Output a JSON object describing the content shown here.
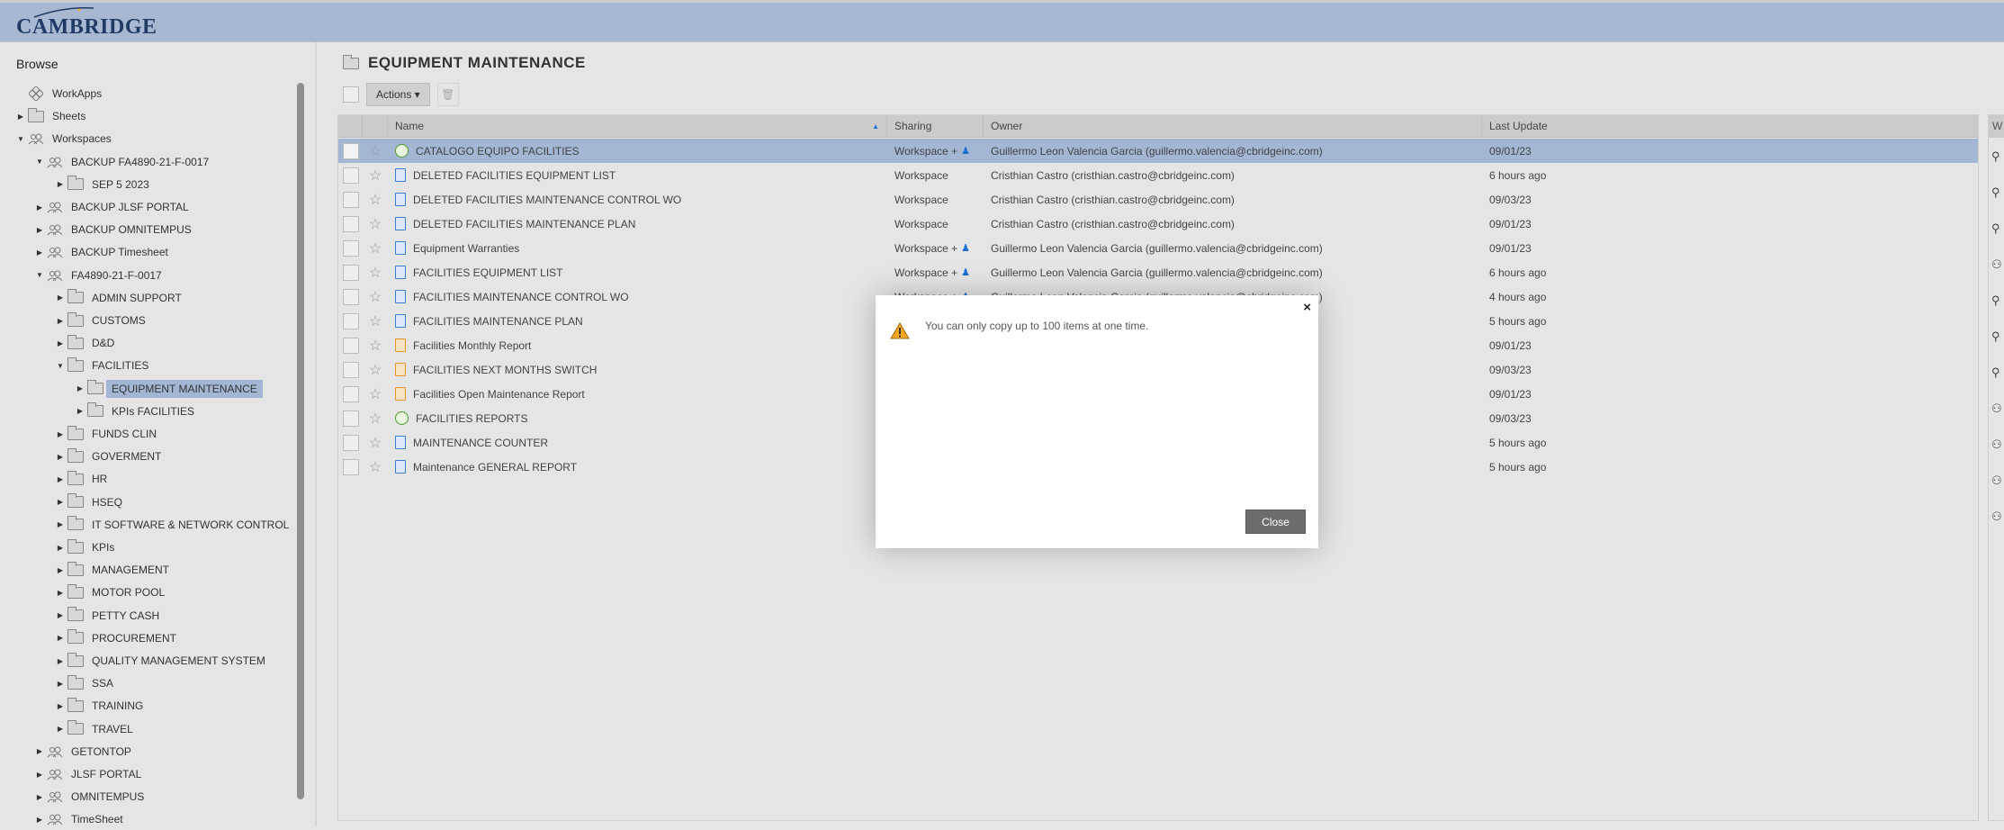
{
  "brand": {
    "logo": "CAMBRIDGE"
  },
  "sidebar": {
    "title": "Browse",
    "items": [
      {
        "label": "WorkApps",
        "level": 0,
        "state": "none",
        "icon": "workapps-icon"
      },
      {
        "label": "Sheets",
        "level": 0,
        "state": "collapsed",
        "icon": "folder-icon"
      },
      {
        "label": "Workspaces",
        "level": 0,
        "state": "expanded",
        "icon": "workspace-icon"
      },
      {
        "label": "BACKUP FA4890-21-F-0017",
        "level": 1,
        "state": "expanded",
        "icon": "workspace-icon"
      },
      {
        "label": "SEP 5 2023",
        "level": 2,
        "state": "collapsed",
        "icon": "folder-icon"
      },
      {
        "label": "BACKUP JLSF PORTAL",
        "level": 1,
        "state": "collapsed",
        "icon": "workspace-icon"
      },
      {
        "label": "BACKUP OMNITEMPUS",
        "level": 1,
        "state": "collapsed",
        "icon": "workspace-icon"
      },
      {
        "label": "BACKUP Timesheet",
        "level": 1,
        "state": "collapsed",
        "icon": "workspace-icon"
      },
      {
        "label": "FA4890-21-F-0017",
        "level": 1,
        "state": "expanded",
        "icon": "workspace-icon"
      },
      {
        "label": "ADMIN SUPPORT",
        "level": 2,
        "state": "collapsed",
        "icon": "folder-icon"
      },
      {
        "label": "CUSTOMS",
        "level": 2,
        "state": "collapsed",
        "icon": "folder-icon"
      },
      {
        "label": "D&D",
        "level": 2,
        "state": "collapsed",
        "icon": "folder-icon"
      },
      {
        "label": "FACILITIES",
        "level": 2,
        "state": "expanded",
        "icon": "folder-icon"
      },
      {
        "label": "EQUIPMENT MAINTENANCE",
        "level": 3,
        "state": "collapsed",
        "icon": "folder-icon",
        "selected": true
      },
      {
        "label": "KPIs FACILITIES",
        "level": 3,
        "state": "collapsed",
        "icon": "folder-icon"
      },
      {
        "label": "FUNDS CLIN",
        "level": 2,
        "state": "collapsed",
        "icon": "folder-icon"
      },
      {
        "label": "GOVERMENT",
        "level": 2,
        "state": "collapsed",
        "icon": "folder-icon"
      },
      {
        "label": "HR",
        "level": 2,
        "state": "collapsed",
        "icon": "folder-icon"
      },
      {
        "label": "HSEQ",
        "level": 2,
        "state": "collapsed",
        "icon": "folder-icon"
      },
      {
        "label": "IT SOFTWARE & NETWORK CONTROL",
        "level": 2,
        "state": "collapsed",
        "icon": "folder-icon"
      },
      {
        "label": "KPIs",
        "level": 2,
        "state": "collapsed",
        "icon": "folder-icon"
      },
      {
        "label": "MANAGEMENT",
        "level": 2,
        "state": "collapsed",
        "icon": "folder-icon"
      },
      {
        "label": "MOTOR POOL",
        "level": 2,
        "state": "collapsed",
        "icon": "folder-icon"
      },
      {
        "label": "PETTY CASH",
        "level": 2,
        "state": "collapsed",
        "icon": "folder-icon"
      },
      {
        "label": "PROCUREMENT",
        "level": 2,
        "state": "collapsed",
        "icon": "folder-icon"
      },
      {
        "label": "QUALITY MANAGEMENT SYSTEM",
        "level": 2,
        "state": "collapsed",
        "icon": "folder-icon"
      },
      {
        "label": "SSA",
        "level": 2,
        "state": "collapsed",
        "icon": "folder-icon"
      },
      {
        "label": "TRAINING",
        "level": 2,
        "state": "collapsed",
        "icon": "folder-icon"
      },
      {
        "label": "TRAVEL",
        "level": 2,
        "state": "collapsed",
        "icon": "folder-icon"
      },
      {
        "label": "GETONTOP",
        "level": 1,
        "state": "collapsed",
        "icon": "workspace-icon"
      },
      {
        "label": "JLSF PORTAL",
        "level": 1,
        "state": "collapsed",
        "icon": "workspace-icon"
      },
      {
        "label": "OMNITEMPUS",
        "level": 1,
        "state": "collapsed",
        "icon": "workspace-icon"
      },
      {
        "label": "TimeSheet",
        "level": 1,
        "state": "collapsed",
        "icon": "workspace-icon"
      }
    ]
  },
  "main": {
    "title": "EQUIPMENT MAINTENANCE",
    "actions_label": "Actions ▾",
    "columns": {
      "name": "Name",
      "sharing": "Sharing",
      "owner": "Owner",
      "last_update": "Last Update",
      "extra": "W"
    },
    "rows": [
      {
        "name": "CATALOGO EQUIPO FACILITIES",
        "type": "report",
        "sharing": "Workspace +",
        "shared_user": true,
        "owner": "Guillermo Leon Valencia Garcia (guillermo.valencia@cbridgeinc.com)",
        "updated": "09/01/23",
        "selected": true
      },
      {
        "name": "DELETED FACILITIES EQUIPMENT LIST",
        "type": "sheet",
        "sharing": "Workspace",
        "shared_user": false,
        "owner": "Cristhian Castro (cristhian.castro@cbridgeinc.com)",
        "updated": "6 hours ago"
      },
      {
        "name": "DELETED FACILITIES MAINTENANCE CONTROL WO",
        "type": "sheet",
        "sharing": "Workspace",
        "shared_user": false,
        "owner": "Cristhian Castro (cristhian.castro@cbridgeinc.com)",
        "updated": "09/03/23"
      },
      {
        "name": "DELETED FACILITIES MAINTENANCE PLAN",
        "type": "sheet",
        "sharing": "Workspace",
        "shared_user": false,
        "owner": "Cristhian Castro (cristhian.castro@cbridgeinc.com)",
        "updated": "09/01/23"
      },
      {
        "name": "Equipment Warranties",
        "type": "sheet",
        "sharing": "Workspace +",
        "shared_user": true,
        "owner": "Guillermo Leon Valencia Garcia (guillermo.valencia@cbridgeinc.com)",
        "updated": "09/01/23"
      },
      {
        "name": "FACILITIES EQUIPMENT LIST",
        "type": "sheet",
        "sharing": "Workspace +",
        "shared_user": true,
        "owner": "Guillermo Leon Valencia Garcia (guillermo.valencia@cbridgeinc.com)",
        "updated": "6 hours ago"
      },
      {
        "name": "FACILITIES MAINTENANCE CONTROL WO",
        "type": "sheet",
        "sharing": "Workspace +",
        "shared_user": true,
        "owner": "Guillermo Leon Valencia Garcia (guillermo.valencia@cbridgeinc.com)",
        "updated": "4 hours ago"
      },
      {
        "name": "FACILITIES MAINTENANCE PLAN",
        "type": "sheet",
        "sharing": "",
        "shared_user": false,
        "owner": "",
        "updated": "5 hours ago"
      },
      {
        "name": "Facilities Monthly Report",
        "type": "dashboard",
        "sharing": "",
        "shared_user": false,
        "owner": "",
        "updated": "09/01/23"
      },
      {
        "name": "FACILITIES NEXT MONTHS SWITCH",
        "type": "dashboard",
        "sharing": "",
        "shared_user": false,
        "owner": "",
        "updated": "09/03/23"
      },
      {
        "name": "Facilities Open Maintenance Report",
        "type": "dashboard",
        "sharing": "",
        "shared_user": false,
        "owner": "",
        "updated": "09/01/23"
      },
      {
        "name": "FACILITIES REPORTS",
        "type": "report",
        "sharing": "",
        "shared_user": false,
        "owner": "",
        "updated": "09/03/23"
      },
      {
        "name": "MAINTENANCE COUNTER",
        "type": "sheet",
        "sharing": "",
        "shared_user": false,
        "owner": "",
        "updated": "5 hours ago"
      },
      {
        "name": "Maintenance GENERAL REPORT",
        "type": "sheet",
        "sharing": "",
        "shared_user": false,
        "owner": "",
        "updated": "5 hours ago"
      }
    ],
    "right_panel_icons": [
      "user",
      "user",
      "user",
      "group",
      "user",
      "user",
      "user",
      "group",
      "group",
      "group",
      "group"
    ]
  },
  "modal": {
    "message": "You can only copy up to 100 items at one time.",
    "close_label": "Close",
    "close_x": "×"
  },
  "colors": {
    "header": "#a8b8d3",
    "selected": "#a3b7d5",
    "warning": "#f5a623",
    "close_button": "#6d6d6d",
    "sheet": "#3a7ecf",
    "dashboard": "#e3962c",
    "report": "#4c9a2a"
  }
}
